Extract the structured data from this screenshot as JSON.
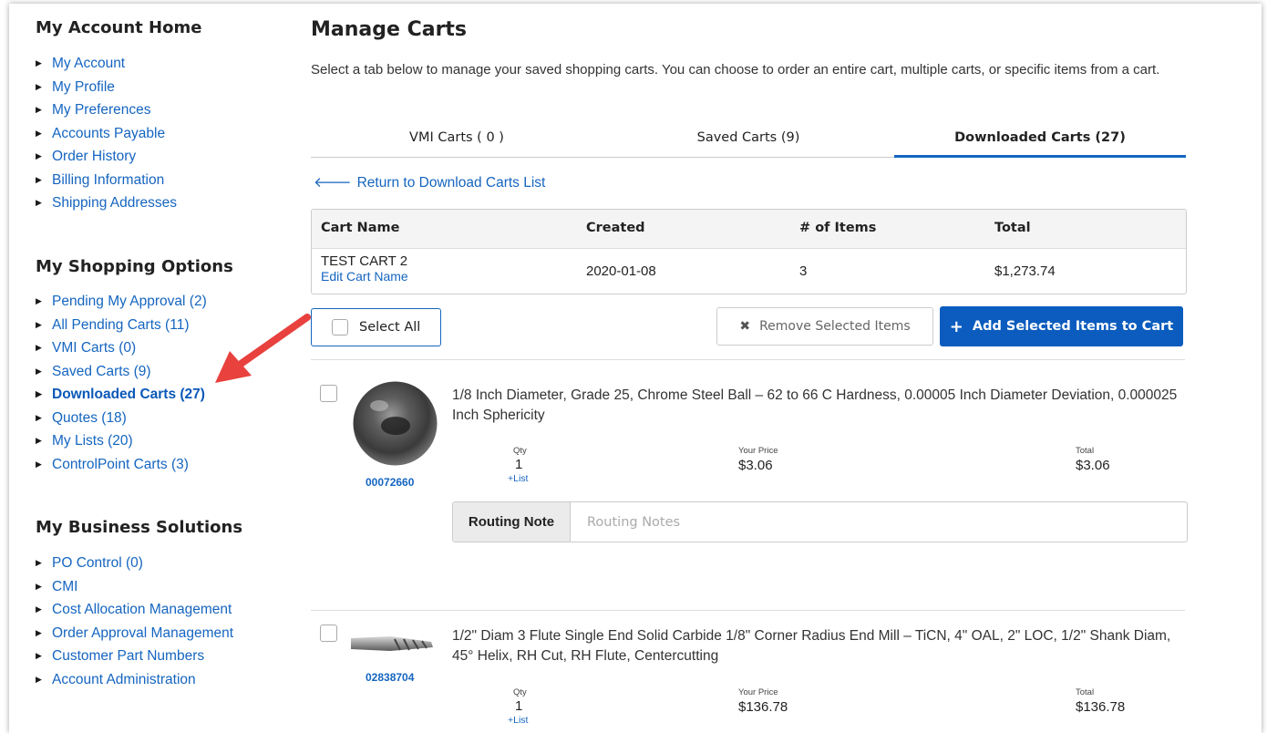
{
  "sidebar": {
    "sections": [
      {
        "title": "My Account Home",
        "items": [
          "My Account",
          "My Profile",
          "My Preferences",
          "Accounts Payable",
          "Order History",
          "Billing Information",
          "Shipping Addresses"
        ]
      },
      {
        "title": "My Shopping Options",
        "items": [
          "Pending My Approval (2)",
          "All Pending Carts (11)",
          "VMI Carts (0)",
          "Saved Carts (9)",
          "Downloaded Carts (27)",
          "Quotes (18)",
          "My Lists (20)",
          "ControlPoint Carts (3)"
        ]
      },
      {
        "title": "My Business Solutions",
        "items": [
          "PO Control (0)",
          "CMI",
          "Cost Allocation Management",
          "Order Approval Management",
          "Customer Part Numbers",
          "Account Administration"
        ]
      }
    ],
    "active_item": "Downloaded Carts (27)"
  },
  "main": {
    "title": "Manage Carts",
    "intro": "Select a tab below to manage your saved shopping carts. You can choose to order an entire cart, multiple carts, or specific items from a cart.",
    "tabs": [
      {
        "label": "VMI Carts ( 0 )",
        "active": false
      },
      {
        "label": "Saved Carts (9)",
        "active": false
      },
      {
        "label": "Downloaded Carts (27)",
        "active": true
      }
    ],
    "back_link": "Return to Download Carts List",
    "cart_table": {
      "headers": [
        "Cart Name",
        "Created",
        "# of Items",
        "Total"
      ],
      "row": {
        "name": "TEST CART 2",
        "edit_link": "Edit Cart Name",
        "created": "2020-01-08",
        "items": "3",
        "total": "$1,273.74"
      }
    },
    "select_all_label": "Select All",
    "remove_button": "Remove Selected Items",
    "add_button": "Add Selected Items to Cart",
    "items": [
      {
        "part": "00072660",
        "description": "1/8 Inch Diameter, Grade 25, Chrome Steel Ball – 62 to 66 C Hardness, 0.00005 Inch Diameter Deviation, 0.000025 Inch Sphericity",
        "qty_label": "Qty",
        "qty": "1",
        "list_link": "+List",
        "price_label": "Your Price",
        "price": "$3.06",
        "total_label": "Total",
        "total": "$3.06",
        "routing_label": "Routing Note",
        "routing_placeholder": "Routing Notes"
      },
      {
        "part": "02838704",
        "description": "1/2\" Diam 3 Flute Single End Solid Carbide 1/8\" Corner Radius End Mill – TiCN, 4\" OAL, 2\" LOC, 1/2\" Shank Diam, 45° Helix, RH Cut, RH Flute, Centercutting",
        "qty_label": "Qty",
        "qty": "1",
        "list_link": "+List",
        "price_label": "Your Price",
        "price": "$136.78",
        "total_label": "Total",
        "total": "$136.78"
      }
    ]
  },
  "colors": {
    "link": "#1565c0",
    "primary_button": "#0b5cbe",
    "annotation_arrow": "#e8413e"
  }
}
